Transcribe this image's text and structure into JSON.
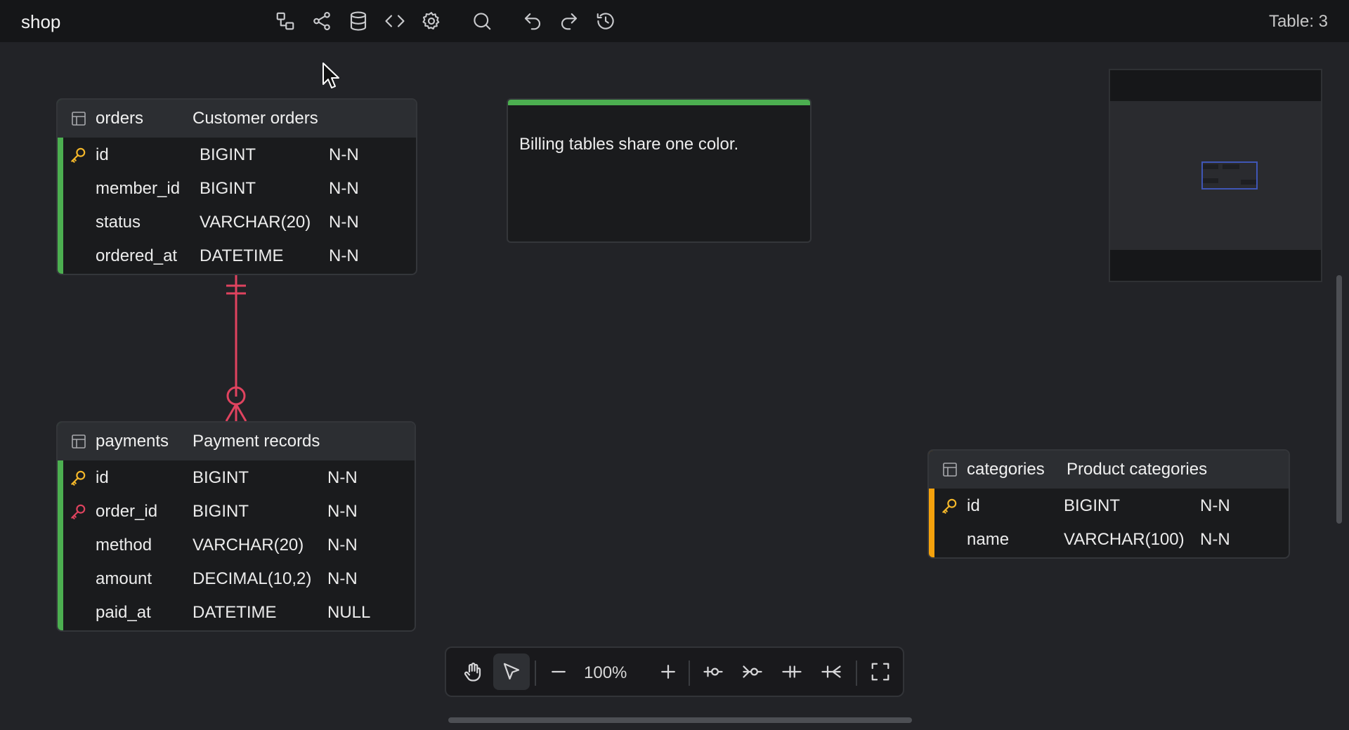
{
  "app": {
    "title": "shop",
    "table_count": "Table: 3"
  },
  "toolbar_top": {
    "icons": [
      "diagram-icon",
      "share-icon",
      "database-icon",
      "code-icon",
      "settings-icon",
      "search-icon",
      "undo-icon",
      "redo-icon",
      "history-icon"
    ]
  },
  "colors": {
    "billing_accent": "#4caf50",
    "catalog_accent": "#f5a20c",
    "relation": "#e0435f",
    "primary_key": "#f5b82a",
    "foreign_key": "#e0435f"
  },
  "tables": {
    "orders": {
      "name": "orders",
      "description": "Customer orders",
      "columns": [
        {
          "name": "id",
          "type": "BIGINT",
          "nullable": "N-N",
          "key": "primary"
        },
        {
          "name": "member_id",
          "type": "BIGINT",
          "nullable": "N-N",
          "key": ""
        },
        {
          "name": "status",
          "type": "VARCHAR(20)",
          "nullable": "N-N",
          "key": ""
        },
        {
          "name": "ordered_at",
          "type": "DATETIME",
          "nullable": "N-N",
          "key": ""
        }
      ]
    },
    "payments": {
      "name": "payments",
      "description": "Payment records",
      "columns": [
        {
          "name": "id",
          "type": "BIGINT",
          "nullable": "N-N",
          "key": "primary"
        },
        {
          "name": "order_id",
          "type": "BIGINT",
          "nullable": "N-N",
          "key": "foreign"
        },
        {
          "name": "method",
          "type": "VARCHAR(20)",
          "nullable": "N-N",
          "key": ""
        },
        {
          "name": "amount",
          "type": "DECIMAL(10,2)",
          "nullable": "N-N",
          "key": ""
        },
        {
          "name": "paid_at",
          "type": "DATETIME",
          "nullable": "NULL",
          "key": ""
        }
      ]
    },
    "categories": {
      "name": "categories",
      "description": "Product categories",
      "columns": [
        {
          "name": "id",
          "type": "BIGINT",
          "nullable": "N-N",
          "key": "primary"
        },
        {
          "name": "name",
          "type": "VARCHAR(100)",
          "nullable": "N-N",
          "key": ""
        }
      ]
    }
  },
  "note": {
    "text": "Billing tables share one color."
  },
  "bottom_toolbar": {
    "zoom": "100%",
    "tools": [
      "hand-tool-icon",
      "select-pointer-icon",
      "zoom-out-icon",
      "zoom-in-icon",
      "relation-one-zero-icon",
      "relation-many-zero-icon",
      "relation-one-one-icon",
      "relation-one-many-icon",
      "fullscreen-icon"
    ]
  }
}
